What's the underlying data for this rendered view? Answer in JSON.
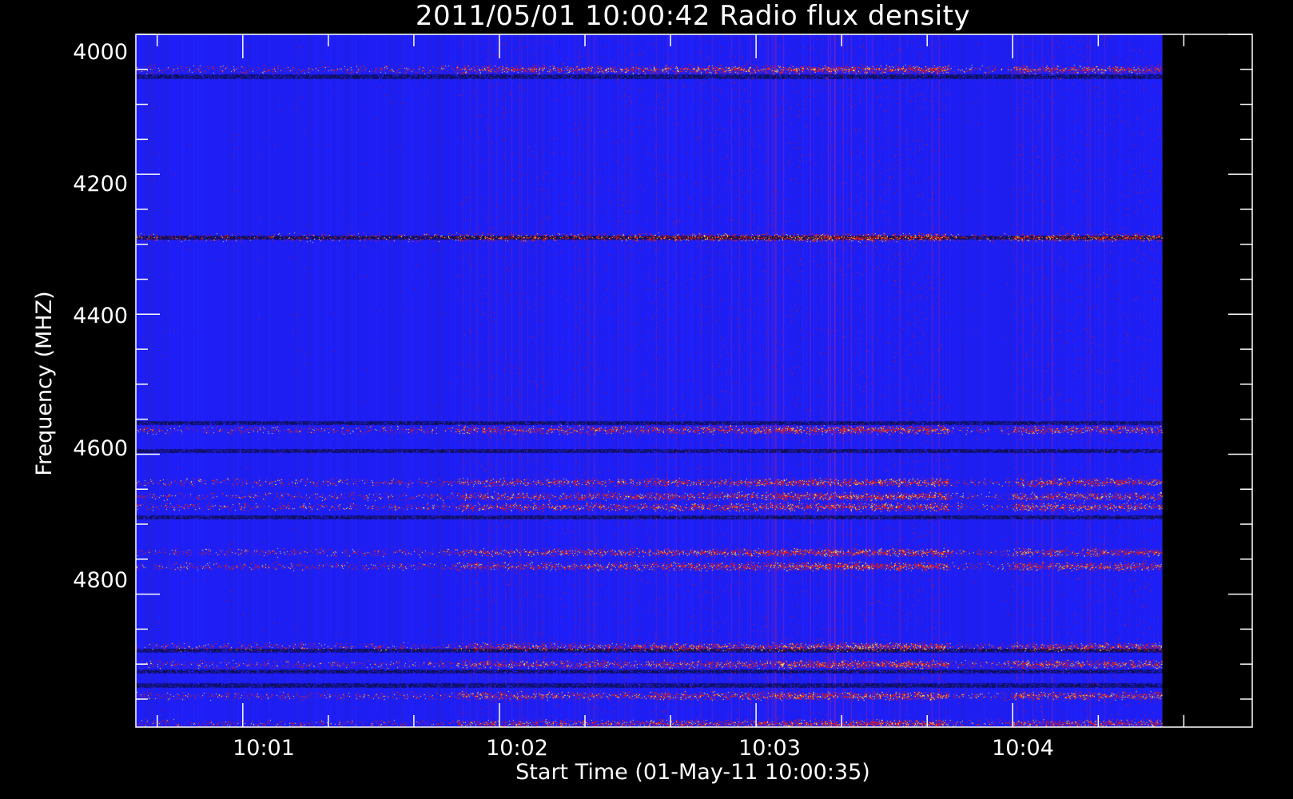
{
  "chart_data": {
    "type": "heatmap",
    "title": "2011/05/01 10:00:42 Radio flux density",
    "xlabel": "Start Time (01-May-11 10:00:35)",
    "ylabel": "Frequency (MHZ)",
    "x_tick_labels": [
      "10:01",
      "10:02",
      "10:03",
      "10:04"
    ],
    "y_tick_labels": [
      "4000",
      "4200",
      "4400",
      "4600",
      "4800"
    ],
    "y_ticks": [
      4000,
      4200,
      4400,
      4600,
      4800
    ],
    "xlim": [
      "10:00:35",
      "10:04:56"
    ],
    "ylim": [
      4000,
      4990
    ],
    "data_extent": {
      "t_start": "10:00:35",
      "t_end": "10:04:35",
      "f_start": 4000,
      "f_end": 4990
    },
    "y_axis_inverted": true,
    "colormap": [
      "#0a0a3a",
      "#1a1aff",
      "#cc1010",
      "#ff3300",
      "#ffff66"
    ],
    "background_color": "#2020ff",
    "axis_color": "#ffffff",
    "emission_bands_mhz": [
      4050,
      4290,
      4565,
      4640,
      4660,
      4675,
      4740,
      4760,
      4875,
      4900,
      4945,
      4985
    ],
    "dark_bands_mhz": [
      4060,
      4290,
      4555,
      4595,
      4690,
      4880,
      4910,
      4930
    ],
    "active_time_windows": [
      {
        "start": "10:01:50",
        "end": "10:02:35",
        "intensity": 0.55
      },
      {
        "start": "10:02:35",
        "end": "10:03:05",
        "intensity": 0.7
      },
      {
        "start": "10:03:05",
        "end": "10:03:45",
        "intensity": 1.0
      },
      {
        "start": "10:04:00",
        "end": "10:04:35",
        "intensity": 0.75
      }
    ]
  }
}
